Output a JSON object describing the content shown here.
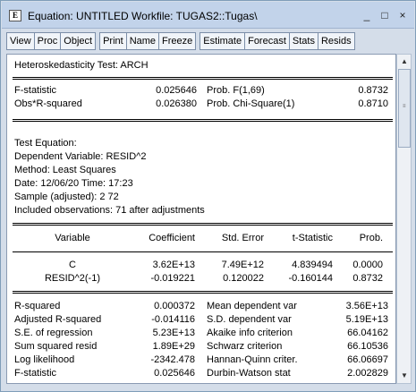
{
  "window": {
    "title": "Equation: UNTITLED   Workfile: TUGAS2::Tugas\\",
    "icon_label": "E",
    "minimize": "_",
    "maximize": "□",
    "close": "×"
  },
  "toolbar": [
    [
      "View",
      "Proc",
      "Object"
    ],
    [
      "Print",
      "Name",
      "Freeze"
    ],
    [
      "Estimate",
      "Forecast",
      "Stats",
      "Resids"
    ]
  ],
  "test": {
    "header": "Heteroskedasticity Test: ARCH",
    "rows": [
      {
        "label": "F-statistic",
        "value": "0.025646",
        "plabel": "Prob. F(1,69)",
        "pvalue": "0.8732"
      },
      {
        "label": "Obs*R-squared",
        "value": "0.026380",
        "plabel": "Prob. Chi-Square(1)",
        "pvalue": "0.8710"
      }
    ]
  },
  "equation_info": [
    "Test Equation:",
    "Dependent Variable: RESID^2",
    "Method: Least Squares",
    "Date: 12/06/20   Time: 17:23",
    "Sample (adjusted): 2 72",
    "Included observations: 71 after adjustments"
  ],
  "coef_table": {
    "headers": [
      "Variable",
      "Coefficient",
      "Std. Error",
      "t-Statistic",
      "Prob."
    ],
    "rows": [
      [
        "C",
        "3.62E+13",
        "7.49E+12",
        "4.839494",
        "0.0000"
      ],
      [
        "RESID^2(-1)",
        "-0.019221",
        "0.120022",
        "-0.160144",
        "0.8732"
      ]
    ]
  },
  "stats": [
    [
      "R-squared",
      "0.000372",
      "Mean dependent var",
      "3.56E+13"
    ],
    [
      "Adjusted R-squared",
      "-0.014116",
      "S.D. dependent var",
      "5.19E+13"
    ],
    [
      "S.E. of regression",
      "5.23E+13",
      "Akaike info criterion",
      "66.04162"
    ],
    [
      "Sum squared resid",
      "1.89E+29",
      "Schwarz criterion",
      "66.10536"
    ],
    [
      "Log likelihood",
      "-2342.478",
      "Hannan-Quinn criter.",
      "66.06697"
    ],
    [
      "F-statistic",
      "0.025646",
      "Durbin-Watson stat",
      "2.002829"
    ]
  ],
  "scrollbar": {
    "up": "▲",
    "down": "▼",
    "grip": "≡"
  }
}
